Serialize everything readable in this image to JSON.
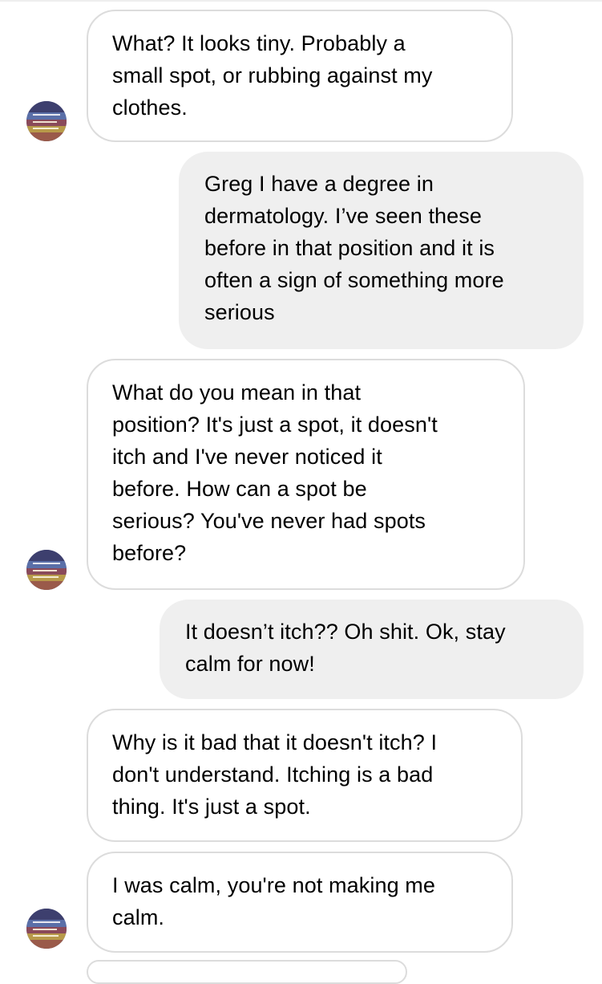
{
  "conversation": {
    "messages": [
      {
        "sender": "other",
        "text": "What? It looks tiny. Probably a\nsmall spot, or rubbing against my\nclothes."
      },
      {
        "sender": "me",
        "text": "Greg I have a degree in\ndermatology. I’ve seen these\nbefore in that position and it is\noften a sign of something more\nserious"
      },
      {
        "sender": "other",
        "text": "What do you mean in that\nposition? It's just a spot, it doesn't\nitch and I've never noticed it\nbefore. How can a spot be\nserious? You've never had spots\nbefore?"
      },
      {
        "sender": "me",
        "text": "It doesn’t itch?? Oh shit. Ok, stay\ncalm for now!"
      },
      {
        "sender": "other",
        "text": "Why is it bad that it doesn't itch? I\ndon't understand. Itching is a bad\nthing. It's just a spot."
      },
      {
        "sender": "other",
        "text": "I was calm, you're not making me\ncalm."
      }
    ]
  },
  "colors": {
    "incoming_bubble_bg": "#ffffff",
    "incoming_bubble_border": "#dcdcdc",
    "outgoing_bubble_bg": "#efefef",
    "text": "#000000"
  },
  "icons": {
    "avatar": "contact-avatar-icon"
  }
}
